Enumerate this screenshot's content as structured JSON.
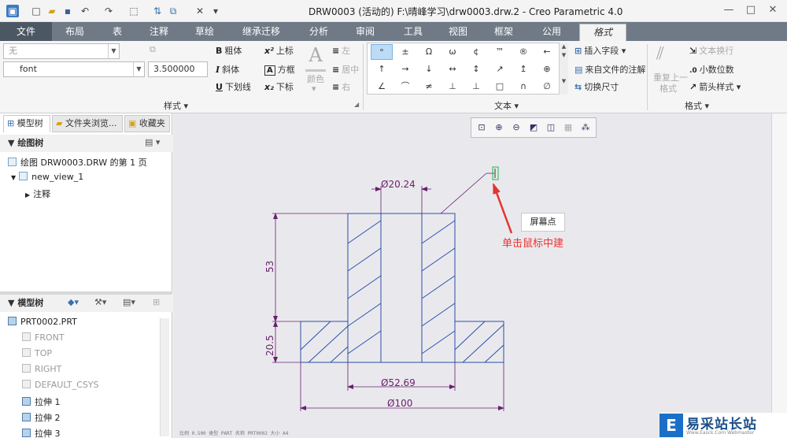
{
  "window": {
    "title": "DRW0003 (活动的) F:\\晴峰学习\\drw0003.drw.2 - Creo Parametric 4.0"
  },
  "menu": {
    "tabs": [
      "文件",
      "布局",
      "表",
      "注释",
      "草绘",
      "继承迁移",
      "分析",
      "审阅",
      "工具",
      "视图",
      "框架",
      "公用",
      "格式"
    ]
  },
  "ribbon": {
    "style_select": "无",
    "font_select": "font",
    "height_value": "3.500000",
    "bold": "粗体",
    "italic": "斜体",
    "underline": "下划线",
    "superscript": "上标",
    "box": "方框",
    "subscript": "下标",
    "color": "颜色",
    "align_left": "左",
    "align_center": "居中",
    "align_right": "右",
    "style_group": "样式",
    "text_group": "文本",
    "format_group": "格式",
    "symbols": [
      "°",
      "±",
      "Ω",
      "ω",
      "¢",
      "™",
      "®",
      "←",
      "↑",
      "→",
      "↓",
      "↔",
      "↕",
      "↗",
      "↥",
      "⊕",
      "∠",
      "⌒",
      "≠",
      "⊥",
      "⊥",
      "□",
      "∩",
      "∅"
    ],
    "insert_field": "插入字段",
    "from_file_note": "来自文件的注解",
    "toggle_dim": "切换尺寸",
    "text_wrap": "文本换行",
    "decimal_places": "小数位数",
    "arrow_style": "箭头样式",
    "repeat_last_format_1": "重复上一",
    "repeat_last_format_2": "格式"
  },
  "panel": {
    "tabs": [
      "模型树",
      "文件夹浏览...",
      "收藏夹"
    ],
    "drawing_tree_header": "绘图树",
    "drawing_root": "绘图 DRW0003.DRW 的第 1 页",
    "view_node": "new_view_1",
    "annotation_node": "注释",
    "model_tree_header": "模型树",
    "model_root": "PRT0002.PRT",
    "model_items": [
      {
        "label": "FRONT",
        "dim": true
      },
      {
        "label": "TOP",
        "dim": true
      },
      {
        "label": "RIGHT",
        "dim": true
      },
      {
        "label": "DEFAULT_CSYS",
        "dim": true
      },
      {
        "label": "拉伸 1",
        "dim": false
      },
      {
        "label": "拉伸 2",
        "dim": false
      },
      {
        "label": "拉伸 3",
        "dim": false
      }
    ]
  },
  "canvas": {
    "dims": {
      "d_top": "Ø20.24",
      "h_top": "53",
      "h_bottom": "20.5",
      "d_mid": "Ø52.69",
      "d_base": "Ø100"
    },
    "tooltip": "屏幕点",
    "annotation": "单击鼠标中建",
    "status": "比例 0.500   类型 PART   名称 PRT0002   大小 A4"
  },
  "watermark": {
    "text": "易采站长站",
    "sub": "Www.Easck.Com  Webmaster"
  },
  "colors": {
    "menu_bar": "#6f7a86",
    "geometry": "#2b4fa8",
    "dimension": "#6a1f6e",
    "annotation": "#e33333"
  }
}
